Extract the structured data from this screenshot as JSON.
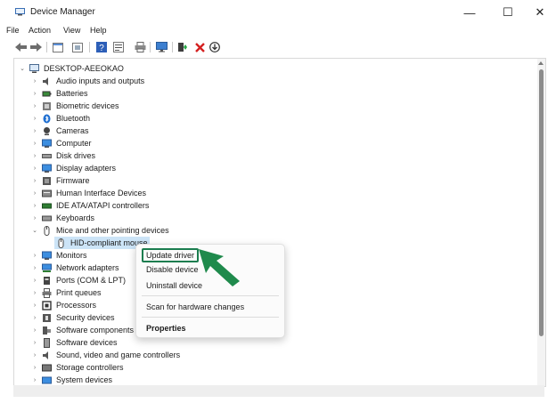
{
  "window": {
    "title": "Device Manager"
  },
  "controls": {
    "minimize": "—",
    "maximize": "☐",
    "close": "✕"
  },
  "menu": [
    "File",
    "Action",
    "View",
    "Help"
  ],
  "tree": {
    "root": "DESKTOP-AEEOKAO",
    "items": [
      {
        "label": "Audio inputs and outputs",
        "icon": "speaker-icon"
      },
      {
        "label": "Batteries",
        "icon": "battery-icon"
      },
      {
        "label": "Biometric devices",
        "icon": "biometric-icon"
      },
      {
        "label": "Bluetooth",
        "icon": "bluetooth-icon"
      },
      {
        "label": "Cameras",
        "icon": "camera-icon"
      },
      {
        "label": "Computer",
        "icon": "computer-icon"
      },
      {
        "label": "Disk drives",
        "icon": "disk-drive-icon"
      },
      {
        "label": "Display adapters",
        "icon": "display-adapter-icon"
      },
      {
        "label": "Firmware",
        "icon": "firmware-icon"
      },
      {
        "label": "Human Interface Devices",
        "icon": "hid-icon"
      },
      {
        "label": "IDE ATA/ATAPI controllers",
        "icon": "ide-controller-icon"
      },
      {
        "label": "Keyboards",
        "icon": "keyboard-icon"
      },
      {
        "label": "Mice and other pointing devices",
        "icon": "mouse-icon"
      },
      {
        "label": "HID-compliant mouse",
        "icon": "mouse-icon"
      },
      {
        "label": "Monitors",
        "icon": "monitor-icon"
      },
      {
        "label": "Network adapters",
        "icon": "network-adapter-icon"
      },
      {
        "label": "Ports (COM & LPT)",
        "icon": "port-icon"
      },
      {
        "label": "Print queues",
        "icon": "printer-icon"
      },
      {
        "label": "Processors",
        "icon": "processor-icon"
      },
      {
        "label": "Security devices",
        "icon": "security-device-icon"
      },
      {
        "label": "Software components",
        "icon": "software-component-icon"
      },
      {
        "label": "Software devices",
        "icon": "software-device-icon"
      },
      {
        "label": "Sound, video and game controllers",
        "icon": "sound-controller-icon"
      },
      {
        "label": "Storage controllers",
        "icon": "storage-controller-icon"
      },
      {
        "label": "System devices",
        "icon": "system-device-icon"
      }
    ]
  },
  "context_menu": {
    "update_driver": "Update driver",
    "disable_device": "Disable device",
    "uninstall_device": "Uninstall device",
    "scan_hardware": "Scan for hardware changes",
    "properties": "Properties"
  },
  "colors": {
    "highlight": "#1b7d4f",
    "selection": "#cce4f7",
    "arrow": "#1f8a4c"
  }
}
